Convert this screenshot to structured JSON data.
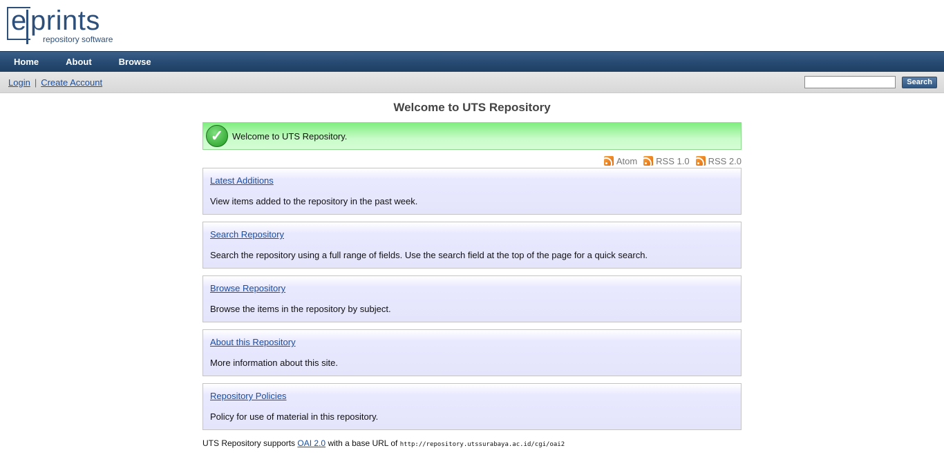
{
  "logo": {
    "mark": "e",
    "name": "prints",
    "tagline": "repository software"
  },
  "nav": {
    "items": [
      "Home",
      "About",
      "Browse"
    ]
  },
  "userbar": {
    "login": "Login",
    "create_account": "Create Account",
    "search_value": "",
    "search_button": "Search"
  },
  "main": {
    "title": "Welcome to UTS Repository",
    "welcome_message": "Welcome to UTS Repository.",
    "feeds": [
      "Atom",
      "RSS 1.0",
      "RSS 2.0"
    ],
    "panels": [
      {
        "link": "Latest Additions",
        "text": "View items added to the repository in the past week."
      },
      {
        "link": "Search Repository",
        "text": "Search the repository using a full range of fields. Use the search field at the top of the page for a quick search."
      },
      {
        "link": "Browse Repository",
        "text": "Browse the items in the repository by subject."
      },
      {
        "link": "About this Repository",
        "text": "More information about this site."
      },
      {
        "link": "Repository Policies",
        "text": "Policy for use of material in this repository."
      }
    ],
    "footer": {
      "prefix": "UTS Repository supports",
      "oai_link": "OAI 2.0",
      "middle": "with a base URL of",
      "base_url": "http://repository.utssurabaya.ac.id/cgi/oai2"
    }
  },
  "colors": {
    "nav_bg": "#264a72",
    "link": "#1a4ea0",
    "welcome_bg": "#c8fbc8",
    "panel_bg": "#e4e4fb",
    "rss_orange": "#e06b0d"
  },
  "icons": [
    "check-icon",
    "rss-icon"
  ]
}
